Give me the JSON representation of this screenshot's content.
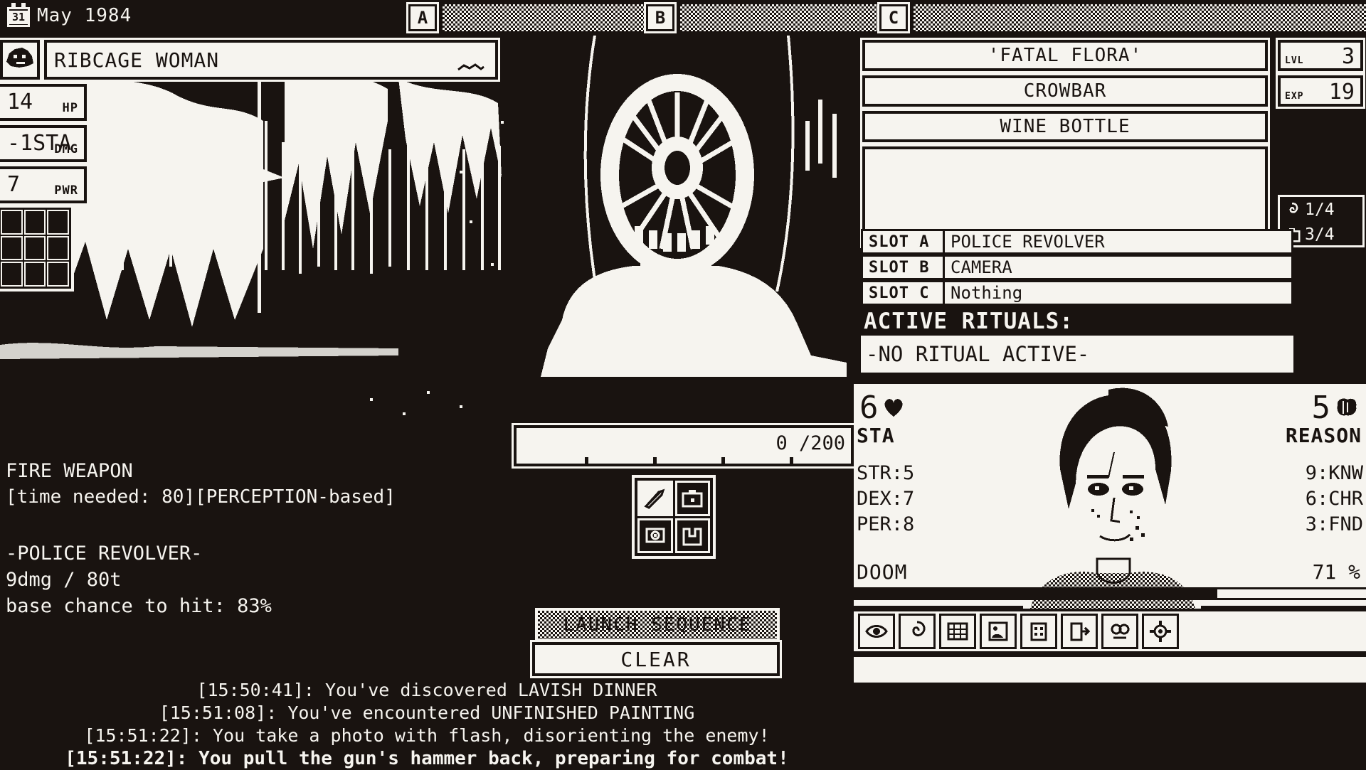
{
  "topbar": {
    "day": "31",
    "date": "May 1984",
    "tabs": [
      {
        "key": "A",
        "name": "tab-a"
      },
      {
        "key": "B",
        "name": "tab-b"
      },
      {
        "key": "C",
        "name": "tab-c"
      }
    ]
  },
  "enemy": {
    "name": "RIBCAGE WOMAN",
    "stats": [
      {
        "value": "14",
        "label": "HP"
      },
      {
        "value": "-1STA",
        "label": "DMG"
      },
      {
        "value": "7",
        "label": "PWR"
      }
    ]
  },
  "action": {
    "title": "FIRE WEAPON",
    "meta": "[time needed: 80][PERCEPTION-based]",
    "weapon_name": "-POLICE REVOLVER-",
    "weapon_stats": "9dmg / 80t",
    "weapon_hit": "base chance to hit: 83%"
  },
  "progress": {
    "value": "0",
    "max": "200",
    "display": "0 /200"
  },
  "buttons": {
    "launch": "LAUNCH SEQUENCE",
    "clear": "CLEAR"
  },
  "action_icons": [
    {
      "name": "knife-icon",
      "active": true
    },
    {
      "name": "camera-icon",
      "active": false
    },
    {
      "name": "revolver-icon",
      "active": false
    },
    {
      "name": "door-icon",
      "active": false
    }
  ],
  "quick_slots": [
    [
      {
        "name": "empty-slot-icon",
        "lit": false,
        "dashed": true
      },
      {
        "name": "hand-icon",
        "lit": true,
        "dashed": false
      },
      {
        "name": "knife-icon",
        "lit": true,
        "dashed": false
      },
      {
        "name": "crossed-swords-icon",
        "lit": true,
        "dashed": false
      }
    ],
    [
      {
        "name": "empty-slot-icon",
        "lit": false,
        "dashed": true
      },
      {
        "name": "kick-icon",
        "lit": true,
        "dashed": false
      },
      {
        "name": "blade-icon",
        "lit": true,
        "dashed": false
      },
      {
        "name": "no-weapon-icon",
        "lit": true,
        "dashed": false
      }
    ],
    [
      {
        "name": "dither-slot-icon",
        "lit": false,
        "dashed": false
      },
      {
        "name": "empty-dark-slot-icon",
        "lit": false,
        "dashed": false
      },
      {
        "name": "empty-dark-slot-icon",
        "lit": false,
        "dashed": false
      },
      {
        "name": "anchor-icon",
        "lit": true,
        "dashed": false
      }
    ]
  ],
  "log": [
    {
      "time": "[15:50:41]",
      "text": ": You've discovered LAVISH DINNER",
      "current": false
    },
    {
      "time": "[15:51:08]",
      "text": ": You've encountered UNFINISHED PAINTING",
      "current": false
    },
    {
      "time": "[15:51:22]",
      "text": ": You take a photo with flash, disorienting the enemy!",
      "current": false
    },
    {
      "time": "[15:51:22]",
      "text": ": You pull the gun's hammer back, preparing for combat!",
      "current": true
    }
  ],
  "sidebar": {
    "inventory": [
      "'FATAL FLORA'",
      "CROWBAR",
      "WINE BOTTLE"
    ],
    "level": {
      "label": "LVL",
      "value": "3"
    },
    "exp": {
      "label": "EXP",
      "value": "19"
    },
    "ammo": [
      {
        "icon": "spiral-icon",
        "value": "1/4"
      },
      {
        "icon": "camera-icon",
        "value": "3/4"
      }
    ],
    "slots": [
      {
        "key": "SLOT A",
        "value": "POLICE REVOLVER"
      },
      {
        "key": "SLOT B",
        "value": "CAMERA"
      },
      {
        "key": "SLOT C",
        "value": "Nothing"
      }
    ],
    "rituals_header": "ACTIVE RITUALS:",
    "rituals_body": "-NO RITUAL ACTIVE-"
  },
  "character": {
    "stamina": {
      "value": "6",
      "label": "STA",
      "icon": "heart-icon"
    },
    "reason": {
      "value": "5",
      "label": "REASON",
      "icon": "brain-icon"
    },
    "attributes_left": [
      "STR:5",
      "DEX:7",
      "PER:8"
    ],
    "attributes_right": [
      "9:KNW",
      "6:CHR",
      "3:FND"
    ],
    "doom": {
      "label": "DOOM",
      "percent": "71 %",
      "fill": 71
    }
  },
  "toolbar_icons": [
    "eye-icon",
    "spiral-icon",
    "map-icon",
    "journal-icon",
    "building-icon",
    "exit-icon",
    "mystery-icon",
    "gear-icon"
  ],
  "colors": {
    "ink": "#191310",
    "paper": "#f6f4ef"
  }
}
